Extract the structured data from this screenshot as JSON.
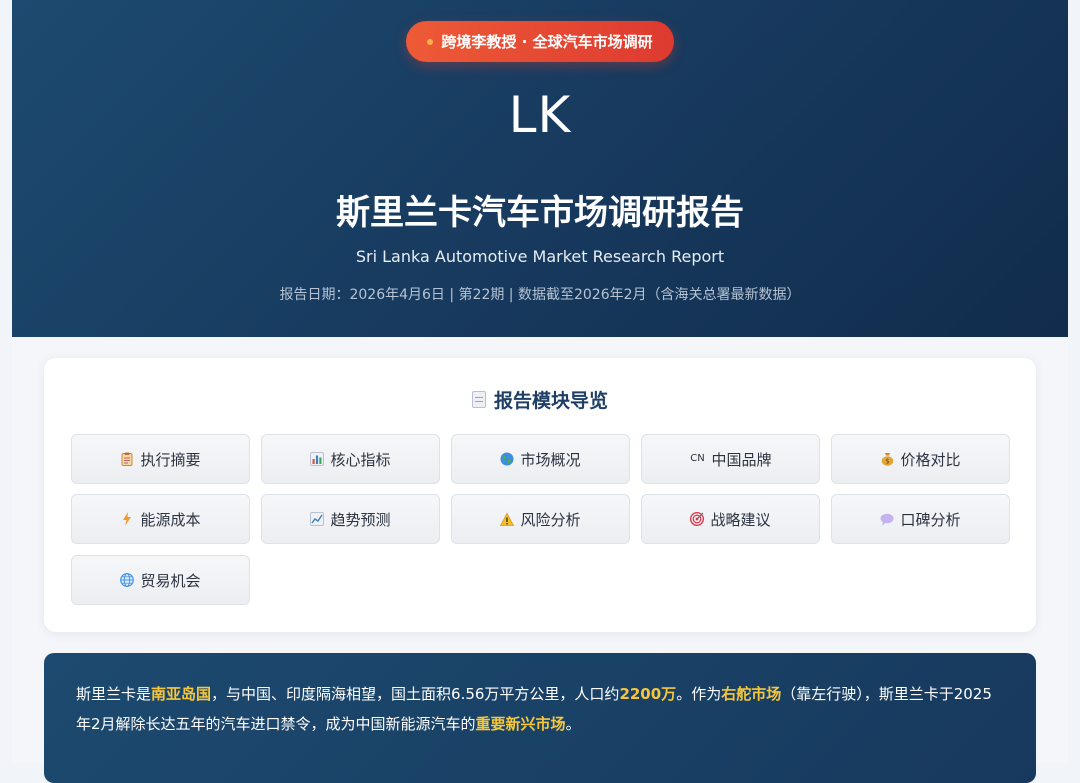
{
  "hero": {
    "badge": "跨境李教授 · 全球汽车市场调研",
    "country_code": "LK",
    "title": "斯里兰卡汽车市场调研报告",
    "subtitle": "Sri Lanka Automotive Market Research Report",
    "meta": "报告日期：2026年4月6日 | 第22期 | 数据截至2026年2月（含海关总署最新数据）"
  },
  "nav": {
    "title": "报告模块导览",
    "items": [
      {
        "label": "执行摘要",
        "icon": "clipboard-icon"
      },
      {
        "label": "核心指标",
        "icon": "bar-chart-icon"
      },
      {
        "label": "市场概况",
        "icon": "globe-icon"
      },
      {
        "label": "中国品牌",
        "icon": "cn-flag-icon",
        "icon_text": "CN"
      },
      {
        "label": "价格对比",
        "icon": "money-bag-icon"
      },
      {
        "label": "能源成本",
        "icon": "lightning-icon"
      },
      {
        "label": "趋势预测",
        "icon": "trend-up-icon"
      },
      {
        "label": "风险分析",
        "icon": "warning-icon"
      },
      {
        "label": "战略建议",
        "icon": "target-icon"
      },
      {
        "label": "口碑分析",
        "icon": "speech-bubble-icon"
      },
      {
        "label": "贸易机会",
        "icon": "globe-grid-icon"
      }
    ]
  },
  "summary": {
    "p1": "斯里兰卡是",
    "h1": "南亚岛国",
    "p2": "，与中国、印度隔海相望，国土面积6.56万平方公里，人口约",
    "h2": "2200万",
    "p3": "。作为",
    "h3": "右舵市场",
    "p4": "（靠左行驶），斯里兰卡于2025年2月解除长达五年的汽车进口禁令，成为中国新能源汽车的",
    "h4": "重要新兴市场",
    "p5": "。"
  },
  "colors": {
    "hero_bg": "#17395d",
    "badge_bg": "#e44a32",
    "highlight": "#f6c73b",
    "nav_title": "#1f3f66"
  }
}
